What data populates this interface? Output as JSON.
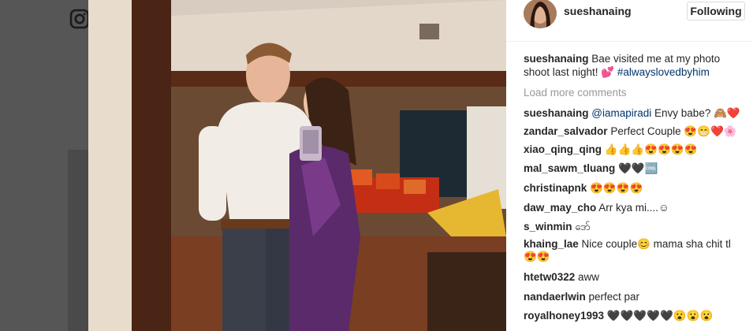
{
  "post": {
    "username": "sueshanaing",
    "follow_label": "Following",
    "caption_username": "sueshanaing",
    "caption_text": " Bae visited me at my photo shoot last night! 💕 ",
    "caption_hashtag": "#alwayslovedbyhim",
    "load_more": "Load more comments"
  },
  "comments": [
    {
      "user": "sueshanaing",
      "mention": "@iamapiradi",
      "text": " Envy babe? 🙈❤️"
    },
    {
      "user": "zandar_salvador",
      "mention": "",
      "text": " Perfect Couple 😍😁❤️🌸"
    },
    {
      "user": "xiao_qing_qing",
      "mention": "",
      "text": " 👍👍👍😍😍😍😍"
    },
    {
      "user": "mal_sawm_tluang",
      "mention": "",
      "text": " 🖤🖤🆒"
    },
    {
      "user": "christinapnk",
      "mention": "",
      "text": " 😍😍😍😍"
    },
    {
      "user": "daw_may_cho",
      "mention": "",
      "text": " Arr kya mi....☺"
    },
    {
      "user": "s_winmin",
      "mention": "",
      "text": " ဒော်"
    },
    {
      "user": "khaing_lae",
      "mention": "",
      "text": " Nice couple😊 mama sha chit tl 😍😍"
    },
    {
      "user": "htetw0322",
      "mention": "",
      "text": " aww"
    },
    {
      "user": "nandaerlwin",
      "mention": "",
      "text": " perfect par"
    },
    {
      "user": "royalhoney1993",
      "mention": "",
      "text": " 🖤🖤🖤🖤🖤😮😮😮"
    }
  ],
  "icons": {
    "instagram": "instagram-icon"
  }
}
